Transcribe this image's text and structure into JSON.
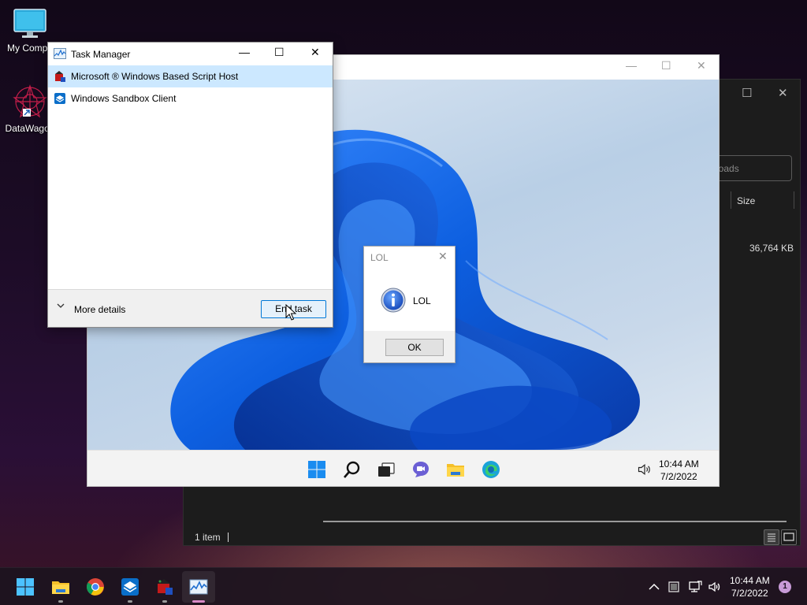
{
  "desktop": {
    "icons": [
      {
        "label": "My Compu",
        "icon": "computer-monitor-icon"
      },
      {
        "label": "DataWagon",
        "icon": "datawagon-starburst-icon"
      }
    ]
  },
  "explorer_window": {
    "address_partial": "loads",
    "column_size_label": "Size",
    "row_size_value": "36,764 KB",
    "status_text": "1 item"
  },
  "sandbox_window": {
    "taskbar": {
      "icons": [
        "windows-start-icon",
        "search-icon",
        "task-view-icon",
        "teams-chat-icon",
        "file-explorer-icon",
        "edge-icon"
      ],
      "time": "10:44 AM",
      "date": "7/2/2022"
    }
  },
  "lol_dialog": {
    "title": "LOL",
    "message": "LOL",
    "ok_label": "OK",
    "icon": "info-icon"
  },
  "task_manager": {
    "title": "Task Manager",
    "processes": [
      {
        "name": "Microsoft ® Windows Based Script Host",
        "icon": "script-host-icon",
        "selected": true
      },
      {
        "name": "Windows Sandbox Client",
        "icon": "sandbox-icon",
        "selected": false
      }
    ],
    "more_details_label": "More details",
    "end_task_label": "End task"
  },
  "taskbar": {
    "pinned": [
      "windows-start-icon",
      "file-explorer-icon",
      "chrome-icon",
      "sandbox-icon",
      "script-host-icon",
      "task-manager-icon"
    ],
    "active": "task-manager-icon",
    "time": "10:44 AM",
    "date": "7/2/2022",
    "notification_count": "1"
  },
  "colors": {
    "accent": "#0078d7",
    "selection": "#cce8ff",
    "notification_badge": "#c89bd8"
  }
}
